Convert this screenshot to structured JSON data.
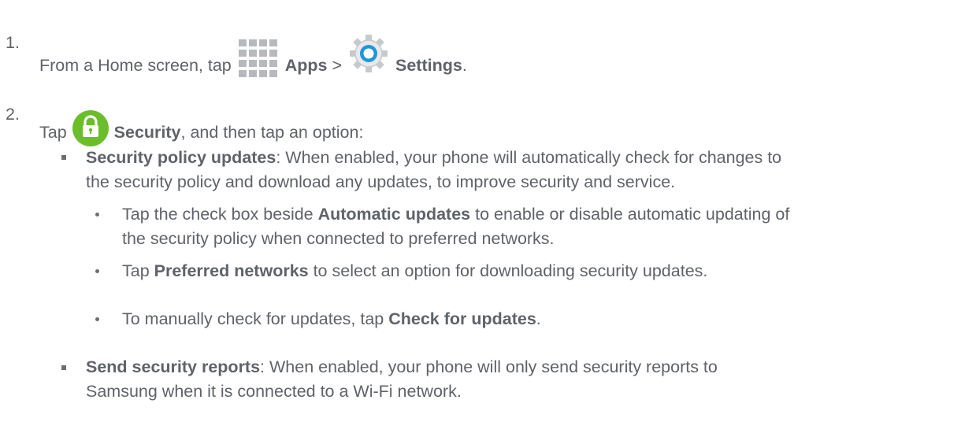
{
  "steps": [
    {
      "number": "1.",
      "parts": {
        "t1": "From a Home screen, tap",
        "apps": "Apps",
        "sep": ">",
        "settings": "Settings",
        "end": "."
      }
    },
    {
      "number": "2.",
      "parts": {
        "t1": "Tap",
        "security": "Security",
        "t2": ", and then tap an option:"
      }
    }
  ],
  "options": [
    {
      "title": "Security policy updates",
      "desc_line1": ": When enabled, your phone will automatically check for changes to",
      "desc_line2": "the security policy and download any updates, to improve security and service.",
      "sub": [
        {
          "pre": "Tap the check box beside ",
          "bold": "Automatic updates",
          "post": " to enable or disable automatic updating of",
          "line2": "the security policy when connected to preferred networks."
        },
        {
          "pre": "Tap ",
          "bold": "Preferred networks",
          "post": " to select an option for downloading security updates."
        },
        {
          "pre": "To manually check for updates, tap ",
          "bold": "Check for updates",
          "post": "."
        }
      ]
    },
    {
      "title": "Send security reports",
      "desc_line1": ": When enabled, your phone will only send security reports to",
      "desc_line2": "Samsung when it is connected to a Wi-Fi network."
    }
  ],
  "icons": {
    "apps": "apps-grid-icon",
    "settings": "settings-gear-icon",
    "security": "security-lock-icon"
  },
  "colors": {
    "text": "#5f6369",
    "security_green": "#6cbd2b",
    "settings_blue": "#2196d8",
    "apps_grid": "#b7babd"
  }
}
